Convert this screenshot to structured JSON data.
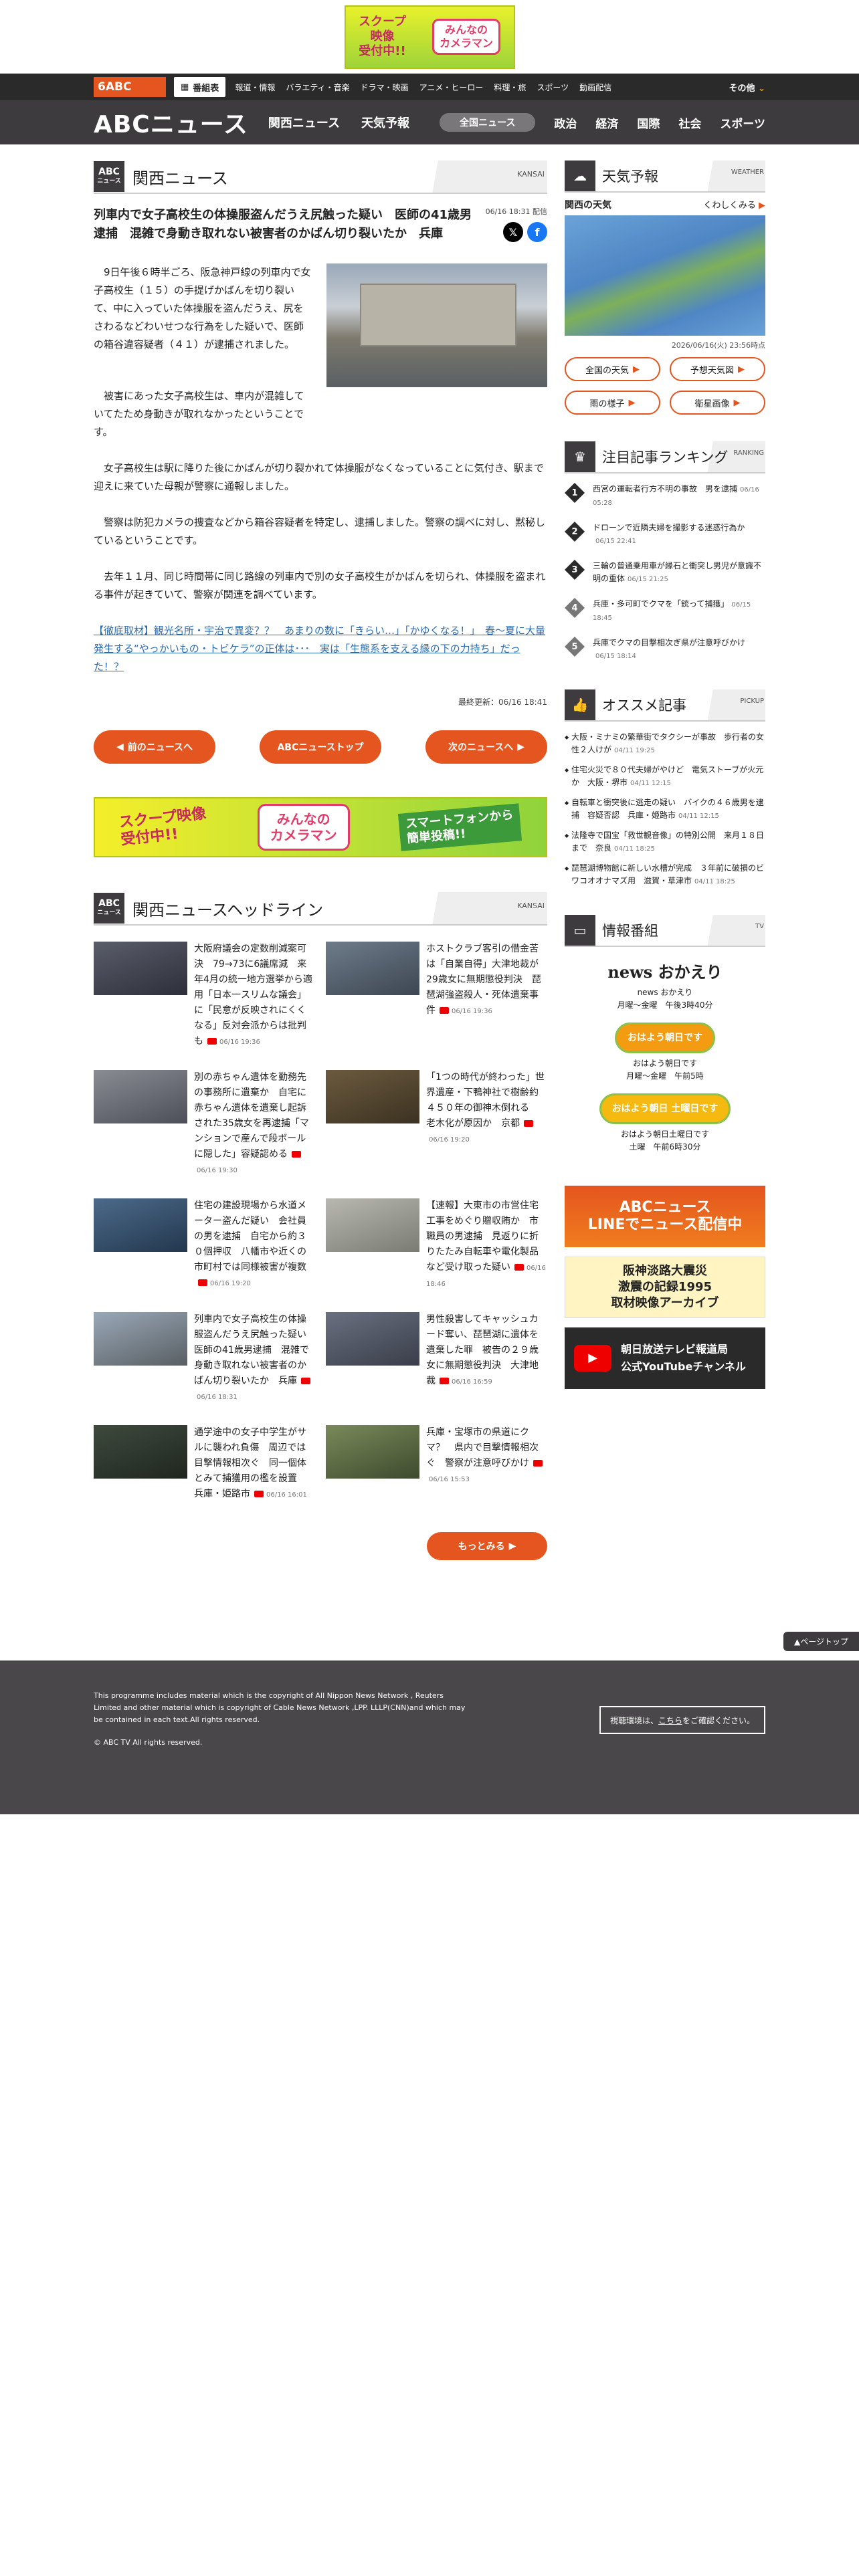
{
  "banner": {
    "left": "スクープ\n映像\n受付中!!",
    "right": "みんなの\nカメラマン"
  },
  "gnav": {
    "logo": "6ABC",
    "program_table": "番組表",
    "links": [
      "報道・情報",
      "バラエティ・音楽",
      "ドラマ・映画",
      "アニメ・ヒーロー",
      "料理・旅",
      "スポーツ",
      "動画配信"
    ],
    "other": "その他"
  },
  "snav": {
    "brand": "ABCニュース",
    "links": [
      "関西ニュース",
      "天気予報"
    ],
    "active": "全国ニュース",
    "right": [
      "政治",
      "経済",
      "国際",
      "社会",
      "スポーツ"
    ]
  },
  "section": {
    "icon_top": "ABC",
    "icon_bottom": "ニュース",
    "title": "関西ニュース",
    "en": "KANSAI"
  },
  "article": {
    "title": "列車内で女子高校生の体操服盗んだうえ尻触った疑い　医師の41歳男逮捕　混雑で身動き取れない被害者のかばん切り裂いたか　兵庫",
    "date": "06/16 18:31 配信",
    "p1": "　9日午後６時半ごろ、阪急神戸線の列車内で女子高校生（１５）の手提げかばんを切り裂いて、中に入っていた体操服を盗んだうえ、尻をさわるなどわいせつな行為をした疑いで、医師の箱谷違容疑者（４１）が逮捕されました。",
    "p2": "　被害にあった女子高校生は、車内が混雑していてたため身動きが取れなかったということです。",
    "p3": "　女子高校生は駅に降りた後にかばんが切り裂かれて体操服がなくなっていることに気付き、駅まで迎えに来ていた母親が警察に通報しました。",
    "p4": "　警察は防犯カメラの捜査などから箱谷容疑者を特定し、逮捕しました。警察の調べに対し、黙秘しているということです。",
    "p5": "　去年１１月、同じ時間帯に同じ路線の列車内で別の女子高校生がかばんを切られ、体操服を盗まれる事件が起きていて、警察が関連を調べています。",
    "link": "【徹底取材】観光名所・宇治で異変？？　あまりの数に「きらい…」「かゆくなる！」　春〜夏に大量発生する“やっかいもの・トビケラ”の正体は･･･　実は「生態系を支える縁の下の力持ち」だった！？",
    "updated": "最終更新：06/16 18:41",
    "prev": "前のニュースへ",
    "top": "ABCニューストップ",
    "next": "次のニュースへ"
  },
  "mid_banner": {
    "left": "スクープ映像\n受付中!!",
    "center": "みんなの\nカメラマン",
    "right": "スマートフォンから\n簡単投稿!!"
  },
  "headlines": {
    "title": "関西ニュースヘッドライン",
    "en": "KANSAI",
    "more": "もっとみる",
    "items": [
      {
        "text": "大阪府議会の定数削減案可決　79→73に6議席減　来年4月の統一地方選挙から適用「日本一スリムな議会」に「民意が反映されにくくなる」反対会派からは批判も",
        "time": "06/16 19:36",
        "bg": "linear-gradient(160deg,#5a5d6a,#2d2f3a)"
      },
      {
        "text": "ホストクラブ客引の借金苦は「自業自得」大津地裁が29歳女に無期懲役判決　琵琶湖強盗殺人・死体遺棄事件",
        "time": "06/16 19:36",
        "bg": "linear-gradient(160deg,#6e7c8a,#3d4652)"
      },
      {
        "text": "別の赤ちゃん遺体を勤務先の事務所に遺棄か　自宅に赤ちゃん遺体を遺棄し起訴された35歳女を再逮捕「マンションで産んで段ボールに隠した」容疑認める",
        "time": "06/16 19:30",
        "bg": "linear-gradient(160deg,#8a8c94,#4d4f58)"
      },
      {
        "text": "「1つの時代が終わった」世界遺産・下鴨神社で樹齢約４５０年の御神木倒れる　老木化が原因か　京都",
        "time": "06/16 19:20",
        "bg": "linear-gradient(160deg,#6b5a3e,#3c3222)"
      },
      {
        "text": "住宅の建設現場から水道メーター盗んだ疑い　会社員の男を逮捕　自宅から約３０個押収　八幡市や近くの市町村では同様被害が複数",
        "time": "06/16 19:20",
        "bg": "linear-gradient(160deg,#4c6a8a,#23374e)"
      },
      {
        "text": "【速報】大東市の市営住宅工事をめぐり贈収賄か　市職員の男逮捕　見返りに折りたたみ自転車や電化製品など受け取った疑い",
        "time": "06/16 18:46",
        "bg": "linear-gradient(160deg,#b8b8b0,#7a7c74)"
      },
      {
        "text": "列車内で女子高校生の体操服盗んだうえ尻触った疑い　医師の41歳男逮捕　混雑で身動き取れない被害者のかばん切り裂いたか　兵庫",
        "time": "06/16 18:31",
        "bg": "linear-gradient(160deg,#9aa8b8,#595f63)"
      },
      {
        "text": "男性殺害してキャッシュカード奪い、琵琶湖に遺体を遺棄した罪　被告の２９歳女に無期懲役判決　大津地裁",
        "time": "06/16 16:59",
        "bg": "linear-gradient(160deg,#6a7080,#3a3e4a)"
      },
      {
        "text": "通学途中の女子中学生がサルに襲われ負傷　周辺では目撃情報相次ぐ　同一個体とみて捕獲用の檻を設置　兵庫・姫路市",
        "time": "06/16 16:01",
        "bg": "linear-gradient(160deg,#3e4a3e,#1f261f)"
      },
      {
        "text": "兵庫・宝塚市の県道にクマ？　県内で目撃情報相次ぐ　警察が注意呼びかけ",
        "time": "06/16 15:53",
        "bg": "linear-gradient(160deg,#7a8a5a,#3e4a2e)"
      }
    ]
  },
  "weather": {
    "title": "天気予報",
    "en": "WEATHER",
    "region": "関西の天気",
    "detail": "くわしくみる",
    "date": "2026/06/16(火) 23:56時点",
    "buttons": [
      "全国の天気",
      "予想天気図",
      "雨の様子",
      "衛星画像"
    ]
  },
  "ranking": {
    "title": "注目記事ランキング",
    "en": "RANKING",
    "items": [
      {
        "n": "1",
        "text": "西宮の運転者行方不明の事故　男を逮捕",
        "time": "06/16 05:28"
      },
      {
        "n": "2",
        "text": "ドローンで近隣夫婦を撮影する迷惑行為か",
        "time": "06/15 22:41"
      },
      {
        "n": "3",
        "text": "三輪の普通乗用車が縁石と衝突し男児が意識不明の重体",
        "time": "06/15 21:25"
      },
      {
        "n": "4",
        "text": "兵庫・多可町でクマを「銃って捕獲」",
        "time": "06/15 18:45"
      },
      {
        "n": "5",
        "text": "兵庫でクマの目撃相次ぎ県が注意呼びかけ",
        "time": "06/15 18:14"
      }
    ]
  },
  "pickup": {
    "title": "オススメ記事",
    "en": "PICKUP",
    "items": [
      {
        "text": "大阪・ミナミの繁華街でタクシーが事故　歩行者の女性２人けが",
        "time": "04/11 19:25"
      },
      {
        "text": "住宅火災で８０代夫婦がやけど　電気ストーブが火元か　大阪・堺市",
        "time": "04/11 12:15"
      },
      {
        "text": "自転車と衝突後に逃走の疑い　バイクの４６歳男を逮捕　容疑否認　兵庫・姫路市",
        "time": "04/11 12:15"
      },
      {
        "text": "法隆寺で国宝「救世観音像」の特別公開　来月１８日まで　奈良",
        "time": "04/11 18:25"
      },
      {
        "text": "琵琶湖博物館に新しい水槽が完成　３年前に破損のビワコオオナマズ用　滋賀・草津市",
        "time": "04/11 18:25"
      }
    ]
  },
  "programs": {
    "title": "情報番組",
    "en": "TV",
    "items": [
      {
        "logo": "news おかえり",
        "t": "news おかえり",
        "s": "月曜〜金曜　午後3時40分"
      },
      {
        "logo": "おはよう朝日です",
        "t": "おはよう朝日です",
        "s": "月曜〜金曜　午前5時"
      },
      {
        "logo": "おはよう朝日 土曜日です",
        "t": "おはよう朝日土曜日です",
        "s": "土曜　午前6時30分"
      }
    ]
  },
  "side_banners": [
    "ABCニュース\nLINEでニュース配信中",
    "阪神淡路大震災\n激震の記録1995\n取材映像アーカイブ",
    "朝日放送テレビ報道局\n公式YouTubeチャンネル"
  ],
  "pagetop": "▲ページトップ",
  "footer": {
    "copy": "This programme includes material which is the copyright of All Nippon News Network , Reuters Limited and other material which is copyright of Cable News Network ,LPP. LLLP(CNN)and which may be contained in each text.All rights reserved.",
    "legal": "© ABC TV All rights reserved.",
    "contact_pre": "視聴環境は、",
    "contact_link": "こちら",
    "contact_post": "をご確認ください。"
  }
}
